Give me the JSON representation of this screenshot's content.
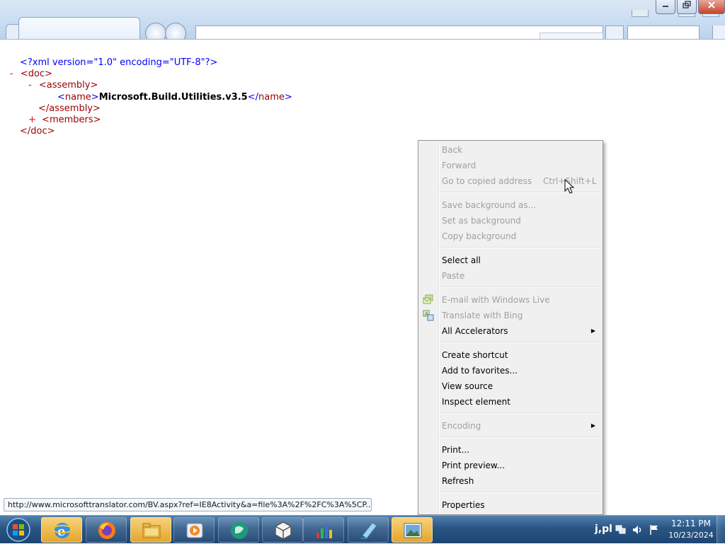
{
  "xml": {
    "declaration": "<?xml version=\"1.0\" encoding=\"UTF-8\"?>",
    "doc_toggle": "-",
    "doc_open": "<doc>",
    "assembly_toggle": "-",
    "assembly_open": "<assembly>",
    "name_open": "<",
    "name_tag": "name",
    "name_close_bracket": ">",
    "name_value": "Microsoft.Build.Utilities.v3.5",
    "name_end_bracket": "</",
    "name_end_tag": "name",
    "name_end_close": ">",
    "assembly_close": "</assembly>",
    "members_toggle": "+",
    "members_open": "<members>",
    "doc_close": "</doc>"
  },
  "context_menu": {
    "back": "Back",
    "forward": "Forward",
    "go_to_copied": "Go to copied address",
    "go_to_copied_shortcut": "Ctrl+Shift+L",
    "save_background": "Save background as...",
    "set_background": "Set as background",
    "copy_background": "Copy background",
    "select_all": "Select all",
    "paste": "Paste",
    "email_live": "E-mail with Windows Live",
    "translate_bing": "Translate with Bing",
    "all_accelerators": "All Accelerators",
    "create_shortcut": "Create shortcut",
    "add_favorites": "Add to favorites...",
    "view_source": "View source",
    "inspect_element": "Inspect element",
    "encoding": "Encoding",
    "print": "Print...",
    "print_preview": "Print preview...",
    "refresh": "Refresh",
    "properties": "Properties"
  },
  "status_url": "http://www.microsofttranslator.com/BV.aspx?ref=IE8Activity&a=file%3A%2F%2FC%3A%5CP...",
  "tray": {
    "language": "j,pl",
    "time": "12:11 PM",
    "date": "10/23/2024"
  },
  "colors": {
    "xml_markup": "#0000ff",
    "xml_tag_name": "#990000",
    "xml_toggle": "#ff0000",
    "menu_disabled": "#a0a0a0",
    "taskbar": "#2a5583"
  }
}
